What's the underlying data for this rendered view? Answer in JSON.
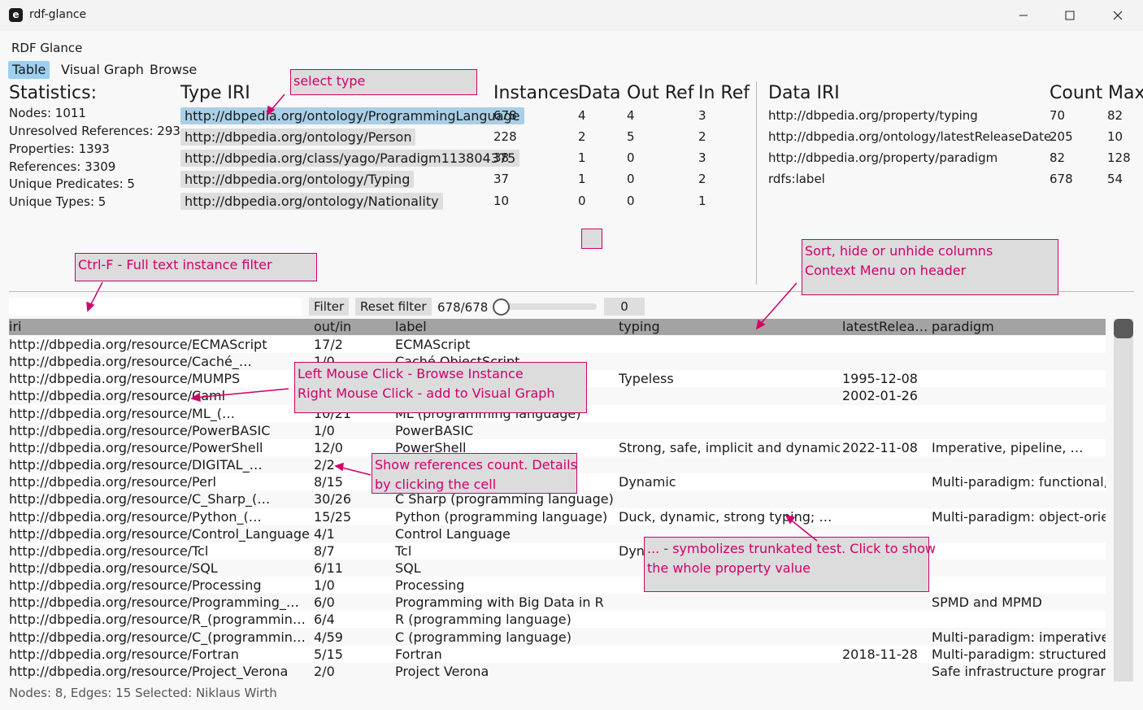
{
  "window": {
    "title": "rdf-glance",
    "app_icon_letter": "e"
  },
  "menu": {
    "app_label": "RDF Glance",
    "tabs": [
      "Table",
      "Visual Graph",
      "Browse"
    ]
  },
  "statistics": {
    "title": "Statistics:",
    "lines": [
      "Nodes: 1011",
      "Unresolved References: 293",
      "Properties: 1393",
      "References: 3309",
      "Unique Predicates: 5",
      "Unique Types: 5"
    ]
  },
  "types_table": {
    "headers": [
      "Type IRI",
      "Instances",
      "Data",
      "Out Ref",
      "In Ref"
    ],
    "rows": [
      {
        "iri": "http://dbpedia.org/ontology/ProgrammingLanguage",
        "instances": "678",
        "data": "4",
        "out": "4",
        "in": "3"
      },
      {
        "iri": "http://dbpedia.org/ontology/Person",
        "instances": "228",
        "data": "2",
        "out": "5",
        "in": "2"
      },
      {
        "iri": "http://dbpedia.org/class/yago/Paradigm113804375",
        "instances": "38",
        "data": "1",
        "out": "0",
        "in": "3"
      },
      {
        "iri": "http://dbpedia.org/ontology/Typing",
        "instances": "37",
        "data": "1",
        "out": "0",
        "in": "2"
      },
      {
        "iri": "http://dbpedia.org/ontology/Nationality",
        "instances": "10",
        "data": "0",
        "out": "0",
        "in": "1"
      }
    ]
  },
  "data_table": {
    "headers": [
      "Data IRI",
      "Count",
      "Max"
    ],
    "rows": [
      {
        "iri": "http://dbpedia.org/property/typing",
        "count": "70",
        "max": "82"
      },
      {
        "iri": "http://dbpedia.org/ontology/latestReleaseDate",
        "count": "205",
        "max": "10"
      },
      {
        "iri": "http://dbpedia.org/property/paradigm",
        "count": "82",
        "max": "128"
      },
      {
        "iri": "rdfs:label",
        "count": "678",
        "max": "54"
      }
    ]
  },
  "filter": {
    "value": "",
    "filter_label": "Filter",
    "reset_label": "Reset filter",
    "count": "678/678",
    "slider_value": 0,
    "slider_label": "0"
  },
  "grid": {
    "headers": [
      "iri",
      "out/in",
      "label",
      "typing",
      "latestRelea…",
      "paradigm"
    ],
    "rows": [
      [
        "http://dbpedia.org/resource/ECMAScript",
        "17/2",
        "ECMAScript",
        "",
        "",
        ""
      ],
      [
        "http://dbpedia.org/resource/Caché_…",
        "1/0",
        "Caché ObjectScript",
        "",
        "",
        ""
      ],
      [
        "http://dbpedia.org/resource/MUMPS",
        "",
        "",
        "Typeless",
        "1995-12-08",
        ""
      ],
      [
        "http://dbpedia.org/resource/Caml",
        "",
        "",
        "",
        "2002-01-26",
        ""
      ],
      [
        "http://dbpedia.org/resource/ML_(…",
        "10/21",
        "ML (programming language)",
        "",
        "",
        ""
      ],
      [
        "http://dbpedia.org/resource/PowerBASIC",
        "1/0",
        "PowerBASIC",
        "",
        "",
        ""
      ],
      [
        "http://dbpedia.org/resource/PowerShell",
        "12/0",
        "PowerShell",
        "Strong, safe, implicit and dynamic",
        "2022-11-08",
        "Imperative, pipeline, …"
      ],
      [
        "http://dbpedia.org/resource/DIGITAL_…",
        "2/2",
        "",
        "",
        "",
        ""
      ],
      [
        "http://dbpedia.org/resource/Perl",
        "8/15",
        "",
        "Dynamic",
        "",
        "Multi-paradigm: functional, …"
      ],
      [
        "http://dbpedia.org/resource/C_Sharp_(…",
        "30/26",
        "C Sharp (programming language)",
        "",
        "",
        ""
      ],
      [
        "http://dbpedia.org/resource/Python_(…",
        "15/25",
        "Python (programming language)",
        "Duck, dynamic, strong typing; …",
        "",
        "Multi-paradigm: object-orien…"
      ],
      [
        "http://dbpedia.org/resource/Control_Language",
        "4/1",
        "Control Language",
        "",
        "",
        ""
      ],
      [
        "http://dbpedia.org/resource/Tcl",
        "8/7",
        "Tcl",
        "Dyn",
        "",
        ""
      ],
      [
        "http://dbpedia.org/resource/SQL",
        "6/11",
        "SQL",
        "",
        "",
        ""
      ],
      [
        "http://dbpedia.org/resource/Processing",
        "1/0",
        "Processing",
        "",
        "",
        ""
      ],
      [
        "http://dbpedia.org/resource/Programming_…",
        "6/0",
        "Programming with Big Data in R",
        "",
        "",
        "SPMD and MPMD"
      ],
      [
        "http://dbpedia.org/resource/R_(programmin…",
        "6/4",
        "R (programming language)",
        "",
        "",
        ""
      ],
      [
        "http://dbpedia.org/resource/C_(programmin…",
        "4/59",
        "C (programming language)",
        "",
        "",
        "Multi-paradigm: imperative , …"
      ],
      [
        "http://dbpedia.org/resource/Fortran",
        "5/15",
        "Fortran",
        "",
        "2018-11-28",
        "Multi-paradigm: structured, …"
      ],
      [
        "http://dbpedia.org/resource/Project_Verona",
        "2/0",
        "Project Verona",
        "",
        "",
        "Safe infrastructure programmi…"
      ]
    ]
  },
  "status": "Nodes: 8, Edges: 15 Selected: Niklaus Wirth",
  "annotations": {
    "select_type": "select type",
    "ctrl_f": "Ctrl-F - Full text instance filter",
    "sort_hide": [
      "Sort, hide or unhide columns",
      "Context Menu on header"
    ],
    "mouse": [
      "Left Mouse Click - Browse Instance",
      "Right Mouse Click - add to Visual Graph"
    ],
    "refs": [
      "Show references count. Details",
      "by clicking the cell"
    ],
    "truncated": [
      "... - symbolizes trunkated test. Click to show",
      "the whole property value"
    ]
  },
  "colors": {
    "accent": "#d0006b",
    "selected_tab": "#9ecff0",
    "header_bg": "#a3a3a3"
  },
  "icons": [
    "minimize-icon",
    "maximize-icon",
    "close-icon"
  ]
}
